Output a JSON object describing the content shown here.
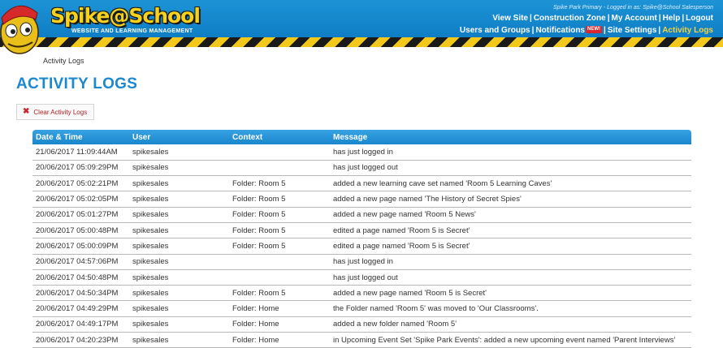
{
  "header": {
    "logo_text": "Spike@School",
    "logo_subtitle": "WEBSITE AND LEARNING MANAGEMENT",
    "login_info": "Spike Park Primary - Logged in as: Spike@School Salesperson",
    "nav_row1": [
      "View Site",
      "Construction Zone",
      "My Account",
      "Help",
      "Logout"
    ],
    "nav_row2": {
      "users_groups": "Users and Groups",
      "notifications": "Notifications",
      "new_badge": "NEW!",
      "site_settings": "Site Settings",
      "activity_logs": "Activity Logs"
    },
    "colors": {
      "bar": "#0b78c0",
      "active_link": "#f3d243",
      "hazard_yellow": "#f2c81a"
    }
  },
  "breadcrumb": "Activity Logs",
  "page_title": "ACTIVITY LOGS",
  "clear_button": {
    "icon": "close-icon",
    "label": "Clear Activity Logs"
  },
  "table": {
    "columns": [
      "Date & Time",
      "User",
      "Context",
      "Message"
    ],
    "rows": [
      [
        "21/06/2017 11:09:44AM",
        "spikesales",
        "",
        "has just logged in"
      ],
      [
        "20/06/2017 05:09:29PM",
        "spikesales",
        "",
        "has just logged out"
      ],
      [
        "20/06/2017 05:02:21PM",
        "spikesales",
        "Folder: Room 5",
        "added a new learning cave set named 'Room 5 Learning Caves'"
      ],
      [
        "20/06/2017 05:02:05PM",
        "spikesales",
        "Folder: Room 5",
        "added a new page named 'The History of Secret Spies'"
      ],
      [
        "20/06/2017 05:01:27PM",
        "spikesales",
        "Folder: Room 5",
        "added a new page named 'Room 5 News'"
      ],
      [
        "20/06/2017 05:00:48PM",
        "spikesales",
        "Folder: Room 5",
        "edited a page named 'Room 5 is Secret'"
      ],
      [
        "20/06/2017 05:00:09PM",
        "spikesales",
        "Folder: Room 5",
        "edited a page named 'Room 5 is Secret'"
      ],
      [
        "20/06/2017 04:57:06PM",
        "spikesales",
        "",
        "has just logged in"
      ],
      [
        "20/06/2017 04:50:48PM",
        "spikesales",
        "",
        "has just logged out"
      ],
      [
        "20/06/2017 04:50:34PM",
        "spikesales",
        "Folder: Room 5",
        "added a new page named 'Room 5 is Secret'"
      ],
      [
        "20/06/2017 04:49:29PM",
        "spikesales",
        "Folder: Home",
        "the Folder named 'Room 5' was moved to 'Our Classrooms'."
      ],
      [
        "20/06/2017 04:49:17PM",
        "spikesales",
        "Folder: Home",
        "added a new folder named 'Room 5'"
      ],
      [
        "20/06/2017 04:20:23PM",
        "spikesales",
        "Folder: Home",
        "in Upcoming Event Set 'Spike Park Events': added a new upcoming event named 'Parent Interviews'"
      ]
    ]
  }
}
